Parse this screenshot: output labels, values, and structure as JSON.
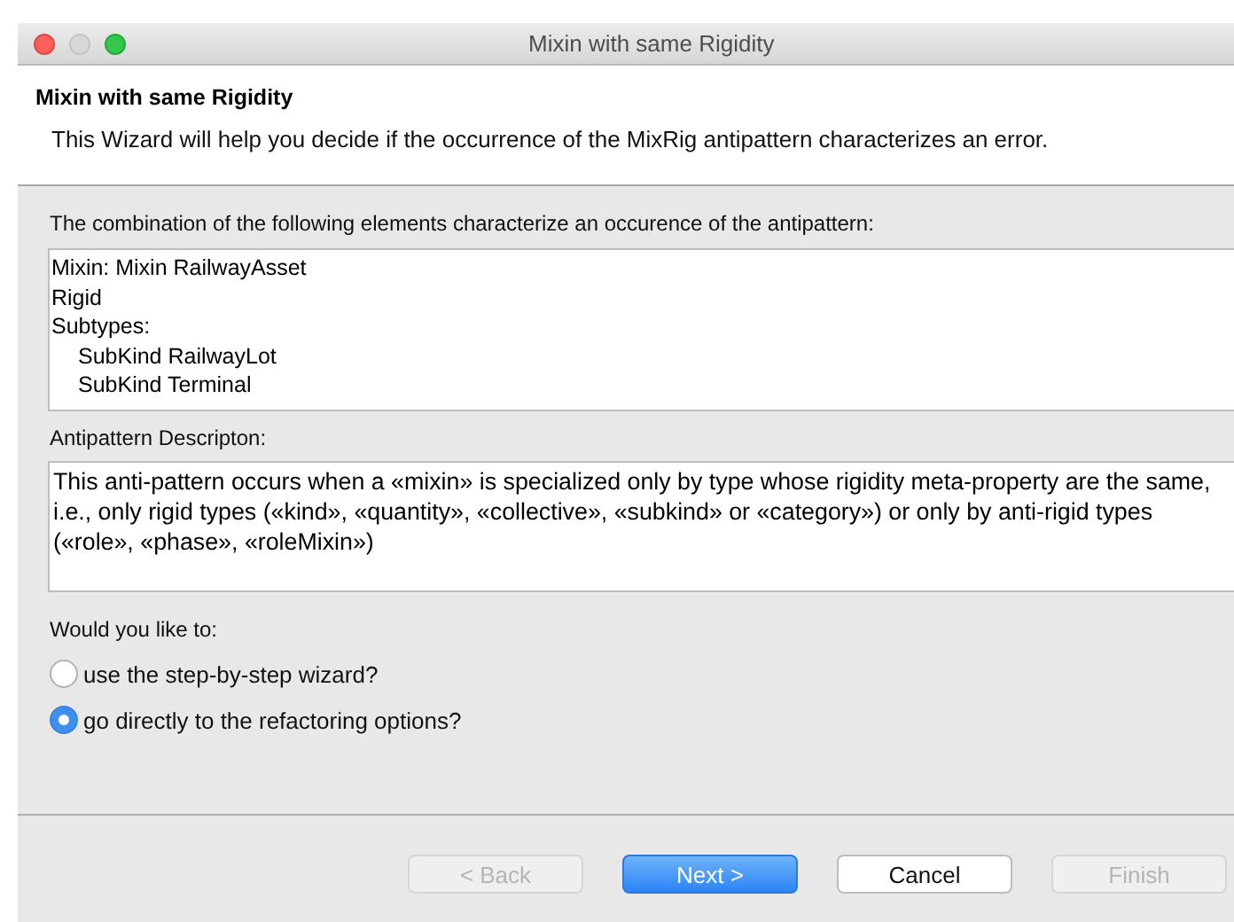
{
  "window": {
    "title": "Mixin with same Rigidity"
  },
  "header": {
    "title": "Mixin with same Rigidity",
    "description": "This Wizard will help you decide if the occurrence of the MixRig antipattern characterizes an error."
  },
  "elements_label": "The combination of the following elements characterize an occurence of the  antipattern:",
  "elements": [
    {
      "text": "Mixin: Mixin RailwayAsset"
    },
    {
      "text": "Rigid"
    },
    {
      "text": "Subtypes:",
      "children": [
        {
          "text": "SubKind RailwayLot"
        },
        {
          "text": "SubKind Terminal"
        }
      ]
    }
  ],
  "description_label": "Antipattern Descripton:",
  "description": "This anti-pattern occurs when a «mixin» is specialized only by type whose rigidity meta-property are the same, i.e., only rigid types («kind», «quantity», «collective», «subkind» or «category») or only by anti-rigid types («role», «phase», «roleMixin»)",
  "question": "Would you like to:",
  "options": [
    {
      "label": "use the step-by-step wizard?",
      "selected": false
    },
    {
      "label": "go directly to the refactoring options?",
      "selected": true
    }
  ],
  "buttons": [
    {
      "label": "< Back",
      "kind": "normal",
      "disabled": true
    },
    {
      "label": "Next >",
      "kind": "default",
      "disabled": false
    },
    {
      "label": "Cancel",
      "kind": "normal",
      "disabled": false
    },
    {
      "label": "Finish",
      "kind": "normal",
      "disabled": true
    }
  ]
}
